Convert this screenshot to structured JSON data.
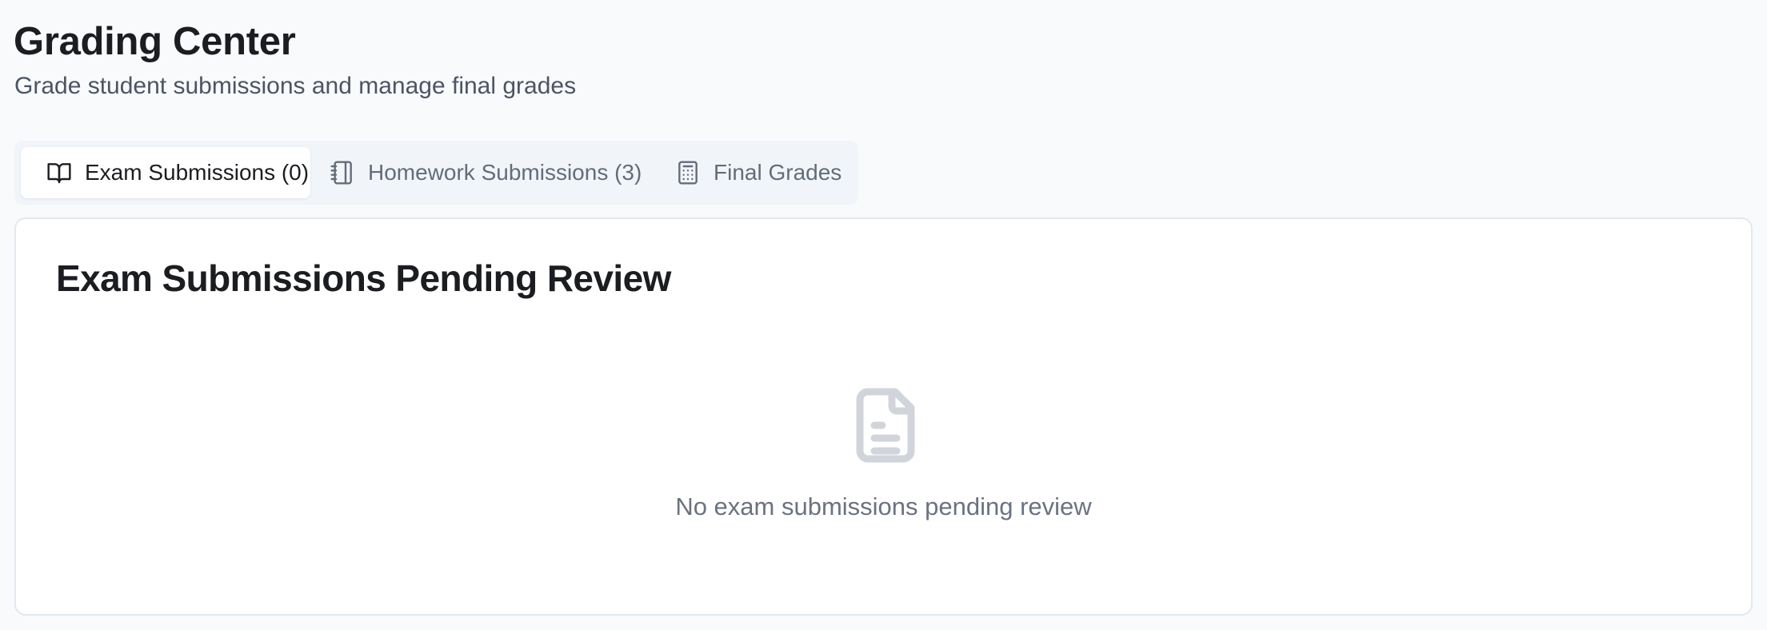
{
  "header": {
    "title": "Grading Center",
    "subtitle": "Grade student submissions and manage final grades"
  },
  "tabs": [
    {
      "label": "Exam Submissions (0)",
      "icon": "book-open-icon",
      "active": true
    },
    {
      "label": "Homework Submissions (3)",
      "icon": "notebook-icon",
      "active": false
    },
    {
      "label": "Final Grades",
      "icon": "calculator-icon",
      "active": false
    }
  ],
  "panel": {
    "title": "Exam Submissions Pending Review",
    "empty_icon": "file-text-icon",
    "empty_message": "No exam submissions pending review"
  },
  "colors": {
    "background": "#f8fafc",
    "tab_bar": "#f1f5f9",
    "card": "#ffffff",
    "muted_text": "#6b7280",
    "empty_icon": "#d1d5db"
  }
}
